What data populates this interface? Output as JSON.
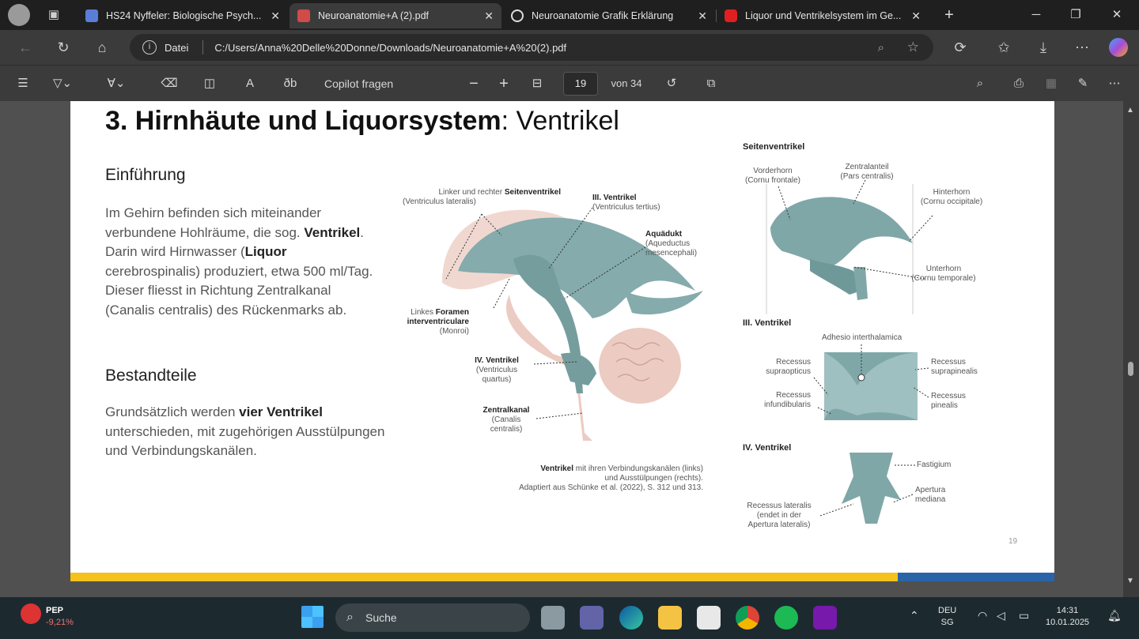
{
  "browser": {
    "tabs": [
      {
        "title": "HS24 Nyffeler: Biologische Psych...",
        "fav": "#5a7dd8",
        "active": false
      },
      {
        "title": "Neuroanatomie+A (2).pdf",
        "fav": "#d14b4b",
        "active": true
      },
      {
        "title": "Neuroanatomie Grafik Erklärung",
        "fav": "#222222",
        "active": false
      },
      {
        "title": "Liquor und Ventrikelsystem im Ge...",
        "fav": "#e02020",
        "active": false
      }
    ],
    "url_prefix": "Datei",
    "url": "C:/Users/Anna%20Delle%20Donne/Downloads/Neuroanatomie+A%20(2).pdf"
  },
  "pdf_toolbar": {
    "copilot": "Copilot fragen",
    "page_current": "19",
    "page_total": "von 34"
  },
  "slide": {
    "title_bold": "3. Hirnhäute und Liquorsystem",
    "title_rest": ": Ventrikel",
    "intro_heading": "Einführung",
    "intro_parts": [
      "Im Gehirn befinden sich miteinander verbundene Hohlräume, die sog. ",
      "Ventrikel",
      ". Darin wird Hirnwasser (",
      "Liquor",
      " cerebrospinalis) produziert, etwa 500 ml/Tag. Dieser fliesst in Richtung Zentralkanal (Canalis centralis) des Rückenmarks ab."
    ],
    "parts_heading": "Bestandteile",
    "parts_parts": [
      "Grundsätzlich werden ",
      "vier Ventrikel",
      " unterschieden, mit zugehörigen Ausstülpungen und Verbindungskanälen."
    ],
    "labels": {
      "seitenventrikel_a": "Linker und rechter ",
      "seitenventrikel_b": "Seitenventrikel",
      "seitenventrikel_c": "(Ventriculus lateralis)",
      "ventrikel3_a": "III. Ventrikel",
      "ventrikel3_b": "(Ventriculus tertius)",
      "aquaedukt_a": "Aquädukt",
      "aquaedukt_b": "(Aqueductus",
      "aquaedukt_c": "mesencephali)",
      "foramen_a": "Linkes ",
      "foramen_b": "Foramen",
      "foramen_c": "interventriculare",
      "foramen_d": "(Monroi)",
      "ventrikel4_a": "IV. Ventrikel",
      "ventrikel4_b": "(Ventriculus",
      "ventrikel4_c": "quartus)",
      "zentralkanal_a": "Zentralkanal",
      "zentralkanal_b": "(Canalis",
      "zentralkanal_c": "centralis)",
      "caption_a": "Ventrikel",
      "caption_b": " mit ihren Verbindungskanälen (links)",
      "caption_c": "und Ausstülpungen (rechts).",
      "caption_d": "Adaptiert aus Schünke et al. (2022), S. 312 und 313."
    },
    "right": {
      "sec1": "Seitenventrikel",
      "vorderhorn_a": "Vorderhorn",
      "vorderhorn_b": "(Cornu frontale)",
      "zentral_a": "Zentralanteil",
      "zentral_b": "(Pars centralis)",
      "hinterhorn_a": "Hinterhorn",
      "hinterhorn_b": "(Cornu occipitale)",
      "unterhorn_a": "Unterhorn",
      "unterhorn_b": "(Cornu temporale)",
      "sec2": "III. Ventrikel",
      "adhesio": "Adhesio interthalamica",
      "rec_supraopt_a": "Recessus",
      "rec_supraopt_b": "supraopticus",
      "rec_infund_a": "Recessus",
      "rec_infund_b": "infundibularis",
      "rec_suprapin_a": "Recessus",
      "rec_suprapin_b": "suprapinealis",
      "rec_pin_a": "Recessus",
      "rec_pin_b": "pinealis",
      "sec3": "IV. Ventrikel",
      "fastigium": "Fastigium",
      "apertura_a": "Apertura",
      "apertura_b": "mediana",
      "rec_lat_a": "Recessus lateralis",
      "rec_lat_b": "(endet in der",
      "rec_lat_c": "Apertura lateralis)"
    },
    "page_number": "19"
  },
  "taskbar": {
    "stock_name": "PEP",
    "stock_change": "-9,21%",
    "search": "Suche",
    "lang_a": "DEU",
    "lang_b": "SG",
    "time": "14:31",
    "date": "10.01.2025"
  }
}
